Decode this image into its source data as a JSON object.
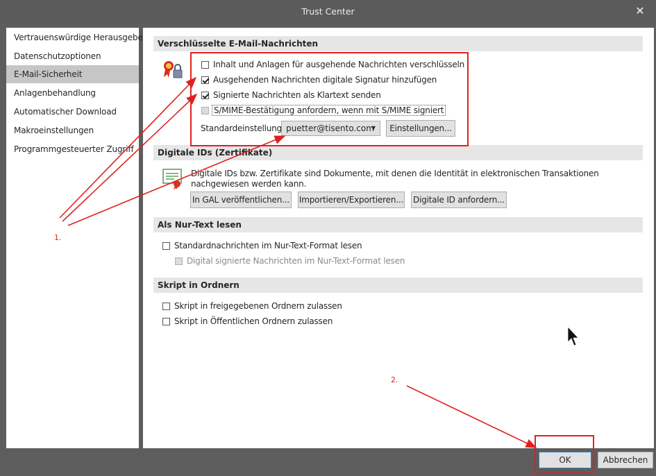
{
  "window": {
    "title": "Trust Center"
  },
  "sidebar": {
    "items": [
      {
        "label": "Vertrauenswürdige Herausgeber"
      },
      {
        "label": "Datenschutzoptionen"
      },
      {
        "label": "E-Mail-Sicherheit",
        "selected": true
      },
      {
        "label": "Anlagenbehandlung"
      },
      {
        "label": "Automatischer Download"
      },
      {
        "label": "Makroeinstellungen"
      },
      {
        "label": "Programmgesteuerter Zugriff"
      }
    ]
  },
  "encrypted": {
    "header": "Verschlüsselte E-Mail-Nachrichten",
    "options": [
      {
        "label": "Inhalt und Anlagen für ausgehende Nachrichten verschlüsseln",
        "checked": false
      },
      {
        "label": "Ausgehenden Nachrichten digitale Signatur hinzufügen",
        "checked": true
      },
      {
        "label": "Signierte Nachrichten als Klartext senden",
        "checked": true
      },
      {
        "label": "S/MIME-Bestätigung anfordern, wenn mit S/MIME signiert",
        "checked": false
      }
    ],
    "default_label": "Standardeinstellung:",
    "default_value": "puetter@tisento.com",
    "settings_button": "Einstellungen..."
  },
  "digital_ids": {
    "header": "Digitale IDs (Zertifikate)",
    "description": "Digitale IDs bzw. Zertifikate sind Dokumente, mit denen die Identität in elektronischen Transaktionen nachgewiesen werden kann.",
    "buttons": [
      "In GAL veröffentlichen...",
      "Importieren/Exportieren...",
      "Digitale ID anfordern..."
    ]
  },
  "plain_text": {
    "header": "Als Nur-Text lesen",
    "options": [
      {
        "label": "Standardnachrichten im Nur-Text-Format lesen",
        "checked": false
      },
      {
        "label": "Digital signierte Nachrichten im Nur-Text-Format lesen",
        "checked": false,
        "disabled": true
      }
    ]
  },
  "script": {
    "header": "Skript in Ordnern",
    "options": [
      {
        "label": "Skript in freigegebenen Ordnern zulassen",
        "checked": false
      },
      {
        "label": "Skript in Öffentlichen Ordnern zulassen",
        "checked": false
      }
    ]
  },
  "footer": {
    "ok": "OK",
    "cancel": "Abbrechen"
  },
  "annotations": {
    "marker1": "1.",
    "marker2": "2.",
    "color": "#e02020"
  },
  "colors": {
    "selected_bg": "#c6c6c6",
    "section_bg": "#e6e6e6",
    "frame": "#5d5d5d"
  }
}
